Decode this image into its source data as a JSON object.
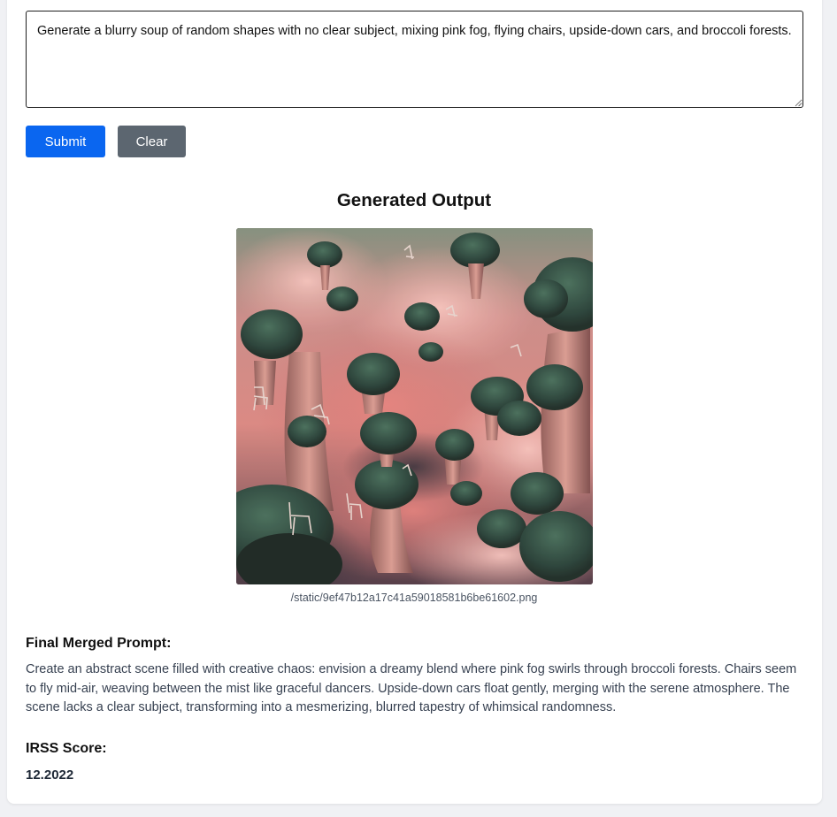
{
  "prompt": {
    "value": "Generate a blurry soup of random shapes with no clear subject, mixing pink fog, flying chairs, upside-down cars, and broccoli forests."
  },
  "buttons": {
    "submit_label": "Submit",
    "clear_label": "Clear"
  },
  "output": {
    "heading": "Generated Output",
    "image_path": "/static/9ef47b12a17c41a59018581b6be61602.png"
  },
  "merged_prompt": {
    "title": "Final Merged Prompt:",
    "text": "Create an abstract scene filled with creative chaos: envision a dreamy blend where pink fog swirls through broccoli forests. Chairs seem to fly mid-air, weaving between the mist like graceful dancers. Upside-down cars float gently, merging with the serene atmosphere. The scene lacks a clear subject, transforming into a mesmerizing, blurred tapestry of whimsical randomness."
  },
  "score": {
    "title": "IRSS Score:",
    "value": "12.2022"
  },
  "colors": {
    "primary": "#0a66f0",
    "secondary": "#5c6670"
  }
}
